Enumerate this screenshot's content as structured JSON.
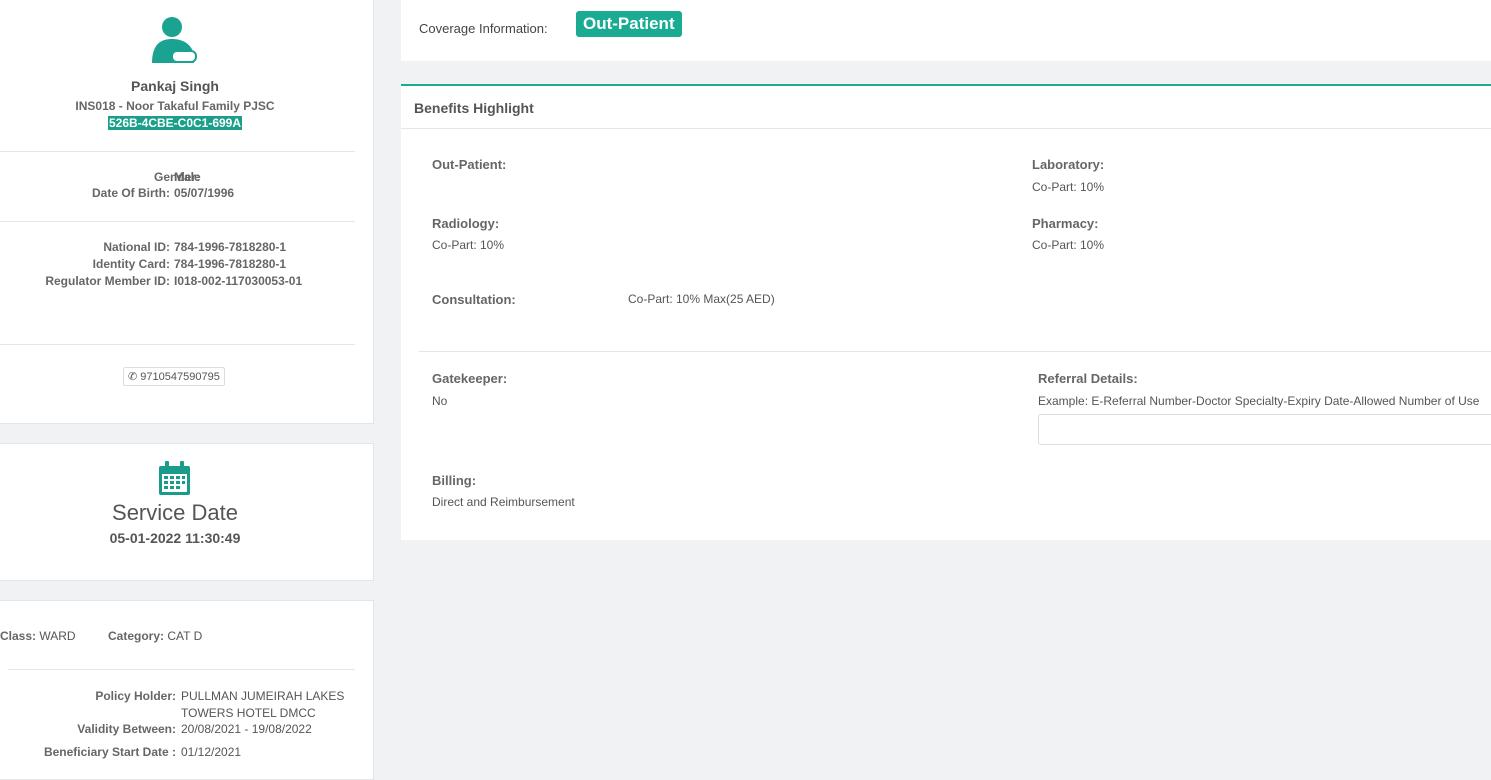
{
  "profile": {
    "name": "Pankaj Singh",
    "insurer": "INS018 - Noor Takaful Family PJSC",
    "card_no": "526B-4CBE-C0C1-699A",
    "gender_label": "Gender:",
    "gender": "Male",
    "dob_label": "Date Of Birth:",
    "dob": "05/07/1996",
    "national_id_label": "National ID:",
    "national_id": "784-1996-7818280-1",
    "identity_card_label": "Identity Card:",
    "identity_card": "784-1996-7818280-1",
    "regulator_label": "Regulator Member ID:",
    "regulator_id": "I018-002-117030053-01",
    "phone": "9710547590795"
  },
  "service": {
    "title": "Service Date",
    "datetime": "05-01-2022 11:30:49"
  },
  "policy": {
    "class_label": "Class:",
    "class": "WARD",
    "category_label": "Category:",
    "category": "CAT D",
    "holder_label": "Policy Holder:",
    "holder_line1": "PULLMAN JUMEIRAH LAKES",
    "holder_line2": "TOWERS HOTEL DMCC",
    "validity_label": "Validity Between:",
    "validity": "20/08/2021 - 19/08/2022",
    "start_label": "Beneficiary Start Date :",
    "start": "01/12/2021"
  },
  "coverage": {
    "label": "Coverage Information:",
    "badge": "Out-Patient"
  },
  "benefits": {
    "title": "Benefits Highlight",
    "out_patient": "Out-Patient:",
    "laboratory": "Laboratory:",
    "laboratory_val": "Co-Part: 10%",
    "radiology": "Radiology:",
    "radiology_val": "Co-Part: 10%",
    "pharmacy": "Pharmacy:",
    "pharmacy_val": "Co-Part: 10%",
    "consultation": "Consultation:",
    "consultation_val": "Co-Part: 10% Max(25 AED)",
    "gatekeeper": "Gatekeeper:",
    "gatekeeper_val": "No",
    "referral": "Referral Details:",
    "referral_hint": "Example: E-Referral Number-Doctor Specialty-Expiry Date-Allowed Number of Use",
    "billing": "Billing:",
    "billing_val": "Direct and Reimbursement"
  },
  "colors": {
    "accent": "#1aac92"
  }
}
